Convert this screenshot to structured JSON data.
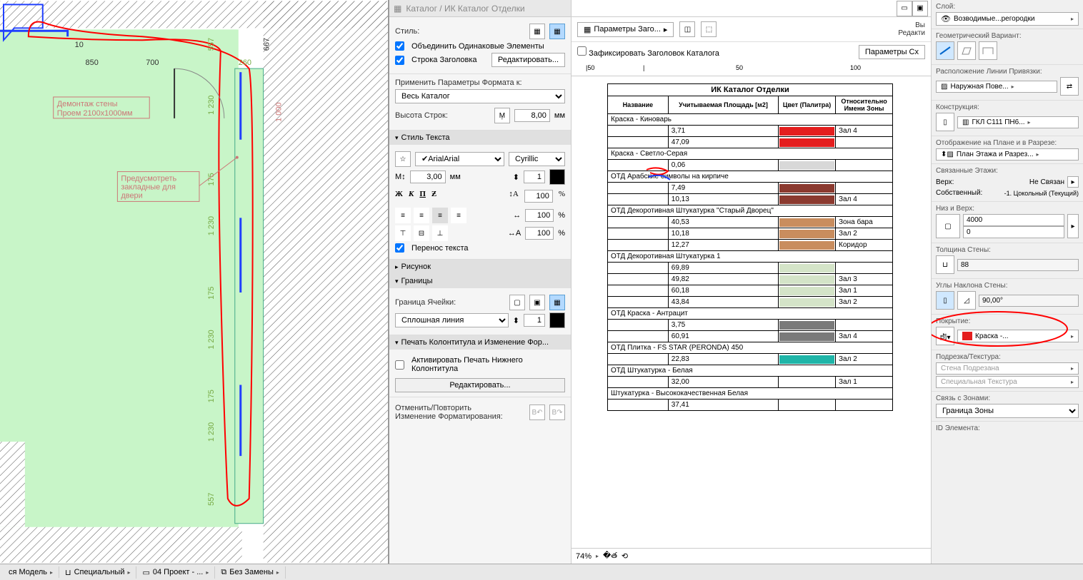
{
  "titlebar": "Каталог / ИК Каталог Отделки",
  "center": {
    "style_lbl": "Стиль:",
    "merge": "Объединить Одинаковые Элементы",
    "header_row": "Строка Заголовка",
    "edit_btn": "Редактировать...",
    "apply_lbl": "Применить Параметры Формата к:",
    "apply_val": "Весь Каталог",
    "row_height_lbl": "Высота Строк:",
    "row_height_val": "8,00",
    "mm": "мм",
    "text_style": "Стиль Текста",
    "font": "Arial",
    "encoding": "Cyrillic",
    "font_size": "3,00",
    "pen": "1",
    "scale1": "100",
    "scale2": "100",
    "scale3": "100",
    "pct": "%",
    "wrap": "Перенос текста",
    "picture": "Рисунок",
    "borders": "Границы",
    "cell_border_lbl": "Граница Ячейки:",
    "line_type": "Сплошная линия",
    "border_pen": "1",
    "footer_section": "Печать Колонтитула и Изменение Фор...",
    "activate_footer": "Активировать Печать Нижнего Колонтитула",
    "edit2": "Редактировать...",
    "undo_lbl1": "Отменить/Повторить",
    "undo_lbl2": "Изменение Форматирования:"
  },
  "catalog": {
    "params_btn": "Параметры Заго...",
    "lock_header": "Зафиксировать Заголовок Каталога",
    "title": "ИК Каталог Отделки",
    "params_scheme": "Параметры Сх",
    "headers": [
      "Название",
      "Учитываемая Площадь [м2]",
      "Цвет (Палитра)",
      "Относительно Имени Зоны"
    ],
    "ruler": {
      "t1": "|50",
      "t2": "|",
      "t3": "50",
      "t4": "100"
    },
    "rows": [
      {
        "type": "header",
        "name": "Краска - Киноварь"
      },
      {
        "type": "data",
        "area": "3,71",
        "color": "#e41e1e",
        "zone": "Зал 4"
      },
      {
        "type": "data",
        "area": "47,09",
        "color": "#e41e1e",
        "zone": ""
      },
      {
        "type": "header",
        "name": "Краска - Светло-Серая"
      },
      {
        "type": "data",
        "area": "0,06",
        "color": "#d8d8d8",
        "zone": ""
      },
      {
        "type": "header",
        "name": "ОТД Арабские символы на кирпиче"
      },
      {
        "type": "data",
        "area": "7,49",
        "color": "#8b3a2f",
        "zone": ""
      },
      {
        "type": "data",
        "area": "10,13",
        "color": "#8b3a2f",
        "zone": "Зал 4"
      },
      {
        "type": "header",
        "name": "ОТД Декоротивная Штукатурка \"Старый Дворец\""
      },
      {
        "type": "data",
        "area": "40,53",
        "color": "#c98d5e",
        "zone": "Зона бара"
      },
      {
        "type": "data",
        "area": "10,18",
        "color": "#c98d5e",
        "zone": "Зал 2"
      },
      {
        "type": "data",
        "area": "12,27",
        "color": "#c98d5e",
        "zone": "Коридор"
      },
      {
        "type": "header",
        "name": "ОТД Декоротивная Штукатурка 1"
      },
      {
        "type": "data",
        "area": "69,89",
        "color": "#d4e4c8",
        "zone": ""
      },
      {
        "type": "data",
        "area": "49,82",
        "color": "#d4e4c8",
        "zone": "Зал 3"
      },
      {
        "type": "data",
        "area": "60,18",
        "color": "#d4e4c8",
        "zone": "Зал 1"
      },
      {
        "type": "data",
        "area": "43,84",
        "color": "#d4e4c8",
        "zone": "Зал 2"
      },
      {
        "type": "header",
        "name": "ОТД Краска - Антрацит"
      },
      {
        "type": "data",
        "area": "3,75",
        "color": "#7a7a7a",
        "zone": ""
      },
      {
        "type": "data",
        "area": "60,91",
        "color": "#7a7a7a",
        "zone": "Зал 4"
      },
      {
        "type": "header",
        "name": "ОТД Плитка - FS STAR (PERONDA) 450"
      },
      {
        "type": "data",
        "area": "22,83",
        "color": "#1fb5a8",
        "zone": "Зал 2"
      },
      {
        "type": "header",
        "name": "ОТД Штукатурка - Белая"
      },
      {
        "type": "data",
        "area": "32,00",
        "color": "#ffffff",
        "zone": "Зал 1"
      },
      {
        "type": "header",
        "name": "Штукатурка - Высококачественная Белая"
      },
      {
        "type": "data",
        "area": "37,41",
        "color": "#ffffff",
        "zone": ""
      }
    ],
    "zoom": "74%"
  },
  "right": {
    "truncated_top1": "Вы",
    "truncated_top2": "Редакти",
    "layer_lbl": "Слой:",
    "layer_val": "Возводимые...регородки",
    "geom_lbl": "Геометрический Вариант:",
    "anchor_lbl": "Расположение Линии Привязки:",
    "anchor_val": "Наружная Пове...",
    "construct_lbl": "Конструкция:",
    "construct_val": "ГКЛ С111 ПН6...",
    "display_lbl": "Отображение на Плане и в Разрезе:",
    "display_val": "План Этажа и Разрез...",
    "linked_lbl": "Связанные Этажи:",
    "top_lbl": "Верх:",
    "top_val": "Не Связан",
    "own_lbl": "Собственный:",
    "own_val": "-1. Цокольный (Текущий)",
    "bottom_lbl": "Низ и Верх:",
    "h1": "4000",
    "h2": "0",
    "thickness_lbl": "Толщина Стены:",
    "thickness_val": "88",
    "angle_lbl": "Углы Наклона Стены:",
    "angle_val": "90,00°",
    "cover_lbl": "Покрытие:",
    "cover_val": "Краска -...",
    "trim_lbl": "Подрезка/Текстура:",
    "trim1": "Стена Подрезана",
    "trim2": "Специальная Текстура",
    "zone_lbl": "Связь с Зонами:",
    "zone_val": "Граница Зоны",
    "elem_id_lbl": "ID Элемента:"
  },
  "status": {
    "s1": "ся Модель",
    "s2": "Специальный",
    "s3": "04 Проект - ...",
    "s4": "Без Замены"
  },
  "floorplan": {
    "dim850": "850",
    "dim700": "700",
    "dim260": "260",
    "dim667": "667",
    "dim557_1": "557",
    "dim557_2": "557",
    "dim1230_1": "1 230",
    "dim1230_2": "1 230",
    "dim1230_3": "1 230",
    "dim1230_4": "1 230",
    "dim1000": "1 000",
    "dim175_1": "175",
    "dim175_2": "175",
    "dim175_3": "175",
    "dim10": "10",
    "note1a": "Демонтаж стены",
    "note1b": "Проем 2100х1000мм",
    "note2a": "Предусмотреть",
    "note2b": "закладные для",
    "note2c": "двери"
  }
}
